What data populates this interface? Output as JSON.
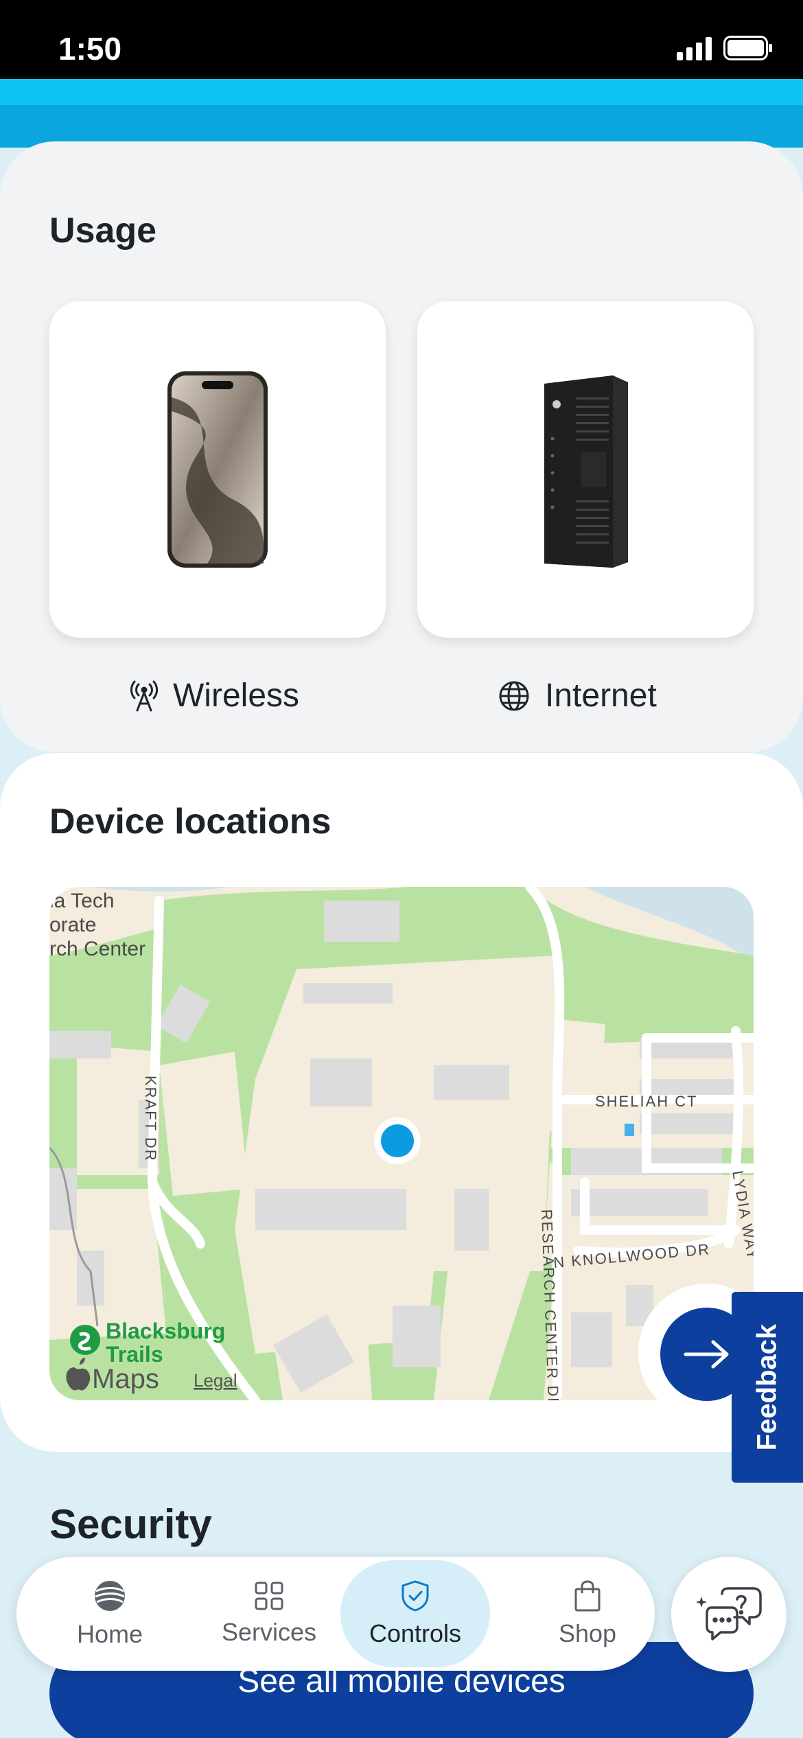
{
  "status_bar": {
    "time": "1:50"
  },
  "usage": {
    "title": "Usage",
    "wireless_label": "Wireless",
    "internet_label": "Internet"
  },
  "device_locations": {
    "title": "Device locations",
    "map_labels": {
      "poi_top_left": [
        "ia Tech",
        "orate",
        "rch Center"
      ],
      "kraft_dr": "KRAFT DR",
      "sheliah_ct": "SHELIAH CT",
      "lydia_way": "LYDIA WAY",
      "knollwood_dr": "N KNOLLWOOD DR",
      "research_center_dr": "RESEARCH CENTER DR",
      "trails_line1": "Blacksburg",
      "trails_line2": "Trails",
      "maps_brand": "Maps",
      "legal": "Legal"
    }
  },
  "feedback": {
    "label": "Feedback"
  },
  "security": {
    "title": "Security"
  },
  "see_all_button": {
    "label": "See all mobile devices"
  },
  "tab_bar": {
    "home": "Home",
    "services": "Services",
    "controls": "Controls",
    "shop": "Shop",
    "selected": "Controls"
  },
  "colors": {
    "brand_blue": "#0d3f9e",
    "accent_cyan": "#0ec4f3",
    "location_dot": "#0a9be0"
  }
}
